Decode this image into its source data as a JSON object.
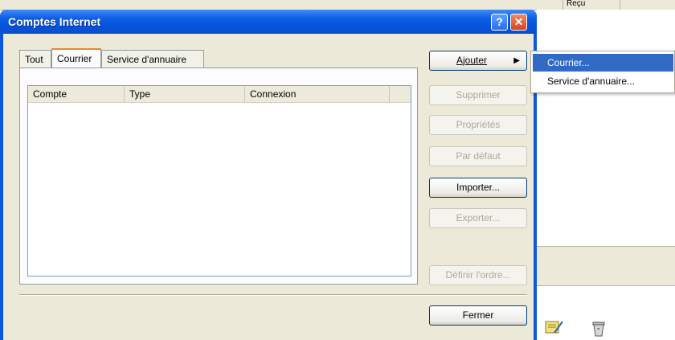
{
  "background_app": {
    "column_header": "Reçu"
  },
  "dialog": {
    "title": "Comptes Internet",
    "help_label": "?",
    "close_label": "✕"
  },
  "tabs": [
    {
      "label": "Tout",
      "active": false
    },
    {
      "label": "Courrier",
      "active": true
    },
    {
      "label": "Service d'annuaire",
      "active": false
    }
  ],
  "list": {
    "columns": [
      "Compte",
      "Type",
      "Connexion"
    ],
    "rows": []
  },
  "buttons": {
    "ajouter": "Ajouter",
    "supprimer": "Supprimer",
    "proprietes": "Propriétés",
    "par_defaut": "Par défaut",
    "importer": "Importer...",
    "exporter": "Exporter...",
    "definir_ordre": "Définir l'ordre...",
    "fermer": "Fermer"
  },
  "menu": {
    "items": [
      "Courrier...",
      "Service d'annuaire..."
    ]
  },
  "colors": {
    "titlebar": "#0a58e0",
    "menu_highlight": "#316ac5",
    "dialog_bg": "#ece9d8"
  }
}
